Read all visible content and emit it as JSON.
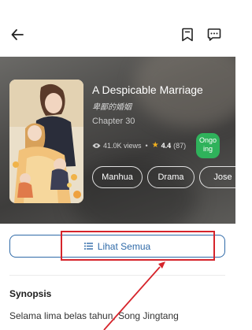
{
  "header": {
    "back_icon": "arrow-left-icon",
    "bookmark_icon": "bookmark-icon",
    "comment_icon": "comment-icon"
  },
  "comic": {
    "title": "A Despicable Marriage",
    "alt_title": "卑鄙的婚姻",
    "chapter": "Chapter 30",
    "views": "41.0K views",
    "rating": "4.4",
    "rating_count": "(87)",
    "status_line1": "Ongo",
    "status_line2": "ing",
    "status_color": "#2fb25b",
    "genres": [
      "Manhua",
      "Drama",
      "Jose"
    ]
  },
  "actions": {
    "see_all_label": "Lihat Semua",
    "accent_color": "#2f6aa8"
  },
  "synopsis": {
    "heading": "Synopsis",
    "text": "Selama lima belas tahun, Song Jingtang"
  }
}
